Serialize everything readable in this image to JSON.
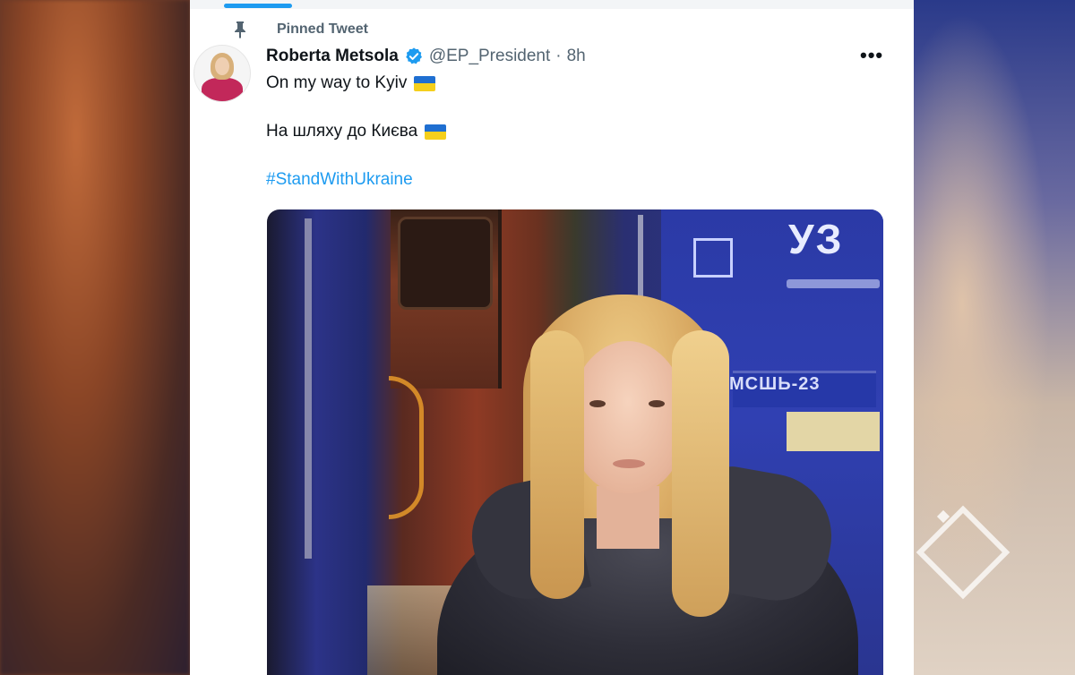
{
  "pinned_label": "Pinned Tweet",
  "tweet": {
    "author_name": "Roberta Metsola",
    "handle": "@EP_President",
    "separator": "·",
    "time": "8h",
    "more_label": "•••",
    "line1": "On my way to Kyiv",
    "line2": "На шляху до Києва",
    "hashtag": "#StandWithUkraine"
  },
  "media": {
    "train_logo": "УЗ",
    "plate_text": "МСШЬ-23"
  },
  "icons": {
    "pin": "pin-icon",
    "verified": "verified-badge-icon",
    "more": "more-options-icon",
    "flag": "ukraine-flag-emoji"
  },
  "colors": {
    "accent": "#1d9bf0",
    "text_primary": "#0f1419",
    "text_secondary": "#536471",
    "flag_blue": "#1f6fd1",
    "flag_yellow": "#f5cf1c"
  }
}
